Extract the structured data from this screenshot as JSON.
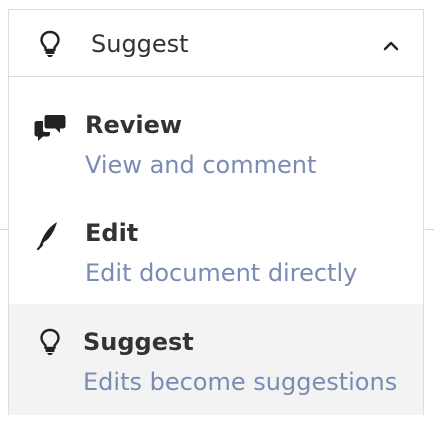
{
  "trigger": {
    "icon": "lightbulb-icon",
    "label": "Suggest",
    "chevron": "chevron-up-icon"
  },
  "options": [
    {
      "icon": "comments-icon",
      "title": "Review",
      "description": "View and comment",
      "selected": false
    },
    {
      "icon": "quill-icon",
      "title": "Edit",
      "description": "Edit document directly",
      "selected": false
    },
    {
      "icon": "lightbulb-icon",
      "title": "Suggest",
      "description": "Edits become suggestions",
      "selected": true
    }
  ],
  "colors": {
    "text": "#333333",
    "description": "#7a8bb4",
    "selected_bg": "#f3f3f3",
    "border": "#dcdcdc"
  }
}
